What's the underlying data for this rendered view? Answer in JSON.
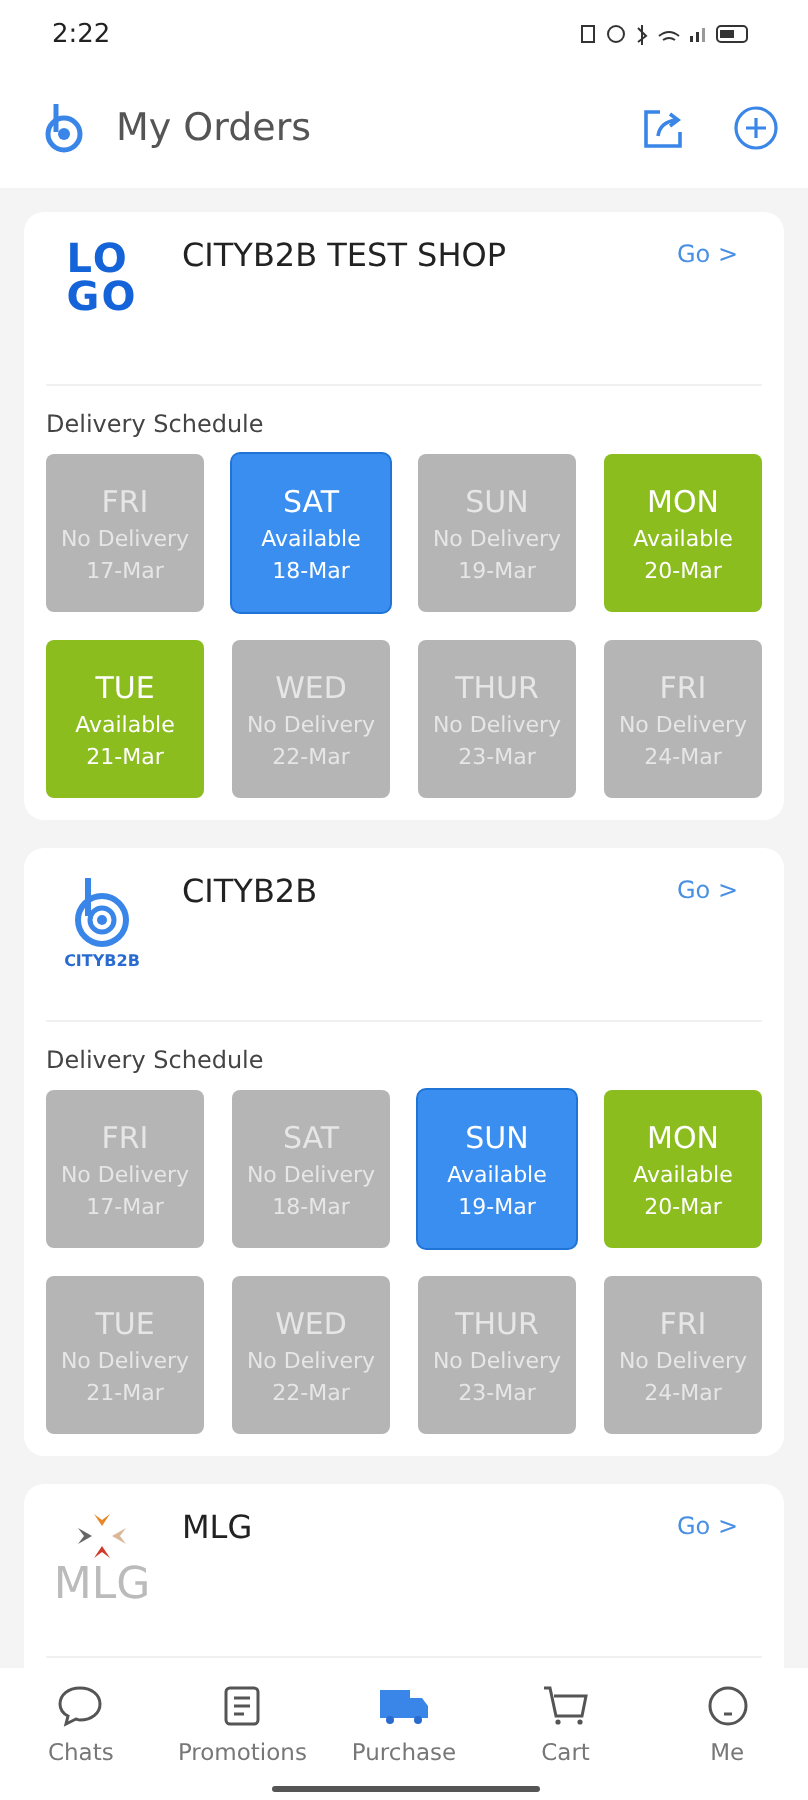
{
  "status_bar": {
    "time": "2:22"
  },
  "header": {
    "title": "My Orders"
  },
  "shops": [
    {
      "name": "CITYB2B TEST SHOP",
      "logo": {
        "kind": "letters",
        "lines": [
          "LO",
          "GO"
        ]
      },
      "go": "Go >",
      "schedule_label": "Delivery Schedule",
      "days": [
        {
          "day": "FRI",
          "status": "No Delivery",
          "date": "17-Mar",
          "available": false,
          "selected": false
        },
        {
          "day": "SAT",
          "status": "Available",
          "date": "18-Mar",
          "available": true,
          "selected": true
        },
        {
          "day": "SUN",
          "status": "No Delivery",
          "date": "19-Mar",
          "available": false,
          "selected": false
        },
        {
          "day": "MON",
          "status": "Available",
          "date": "20-Mar",
          "available": true,
          "selected": false
        },
        {
          "day": "TUE",
          "status": "Available",
          "date": "21-Mar",
          "available": true,
          "selected": false
        },
        {
          "day": "WED",
          "status": "No Delivery",
          "date": "22-Mar",
          "available": false,
          "selected": false
        },
        {
          "day": "THUR",
          "status": "No Delivery",
          "date": "23-Mar",
          "available": false,
          "selected": false
        },
        {
          "day": "FRI",
          "status": "No Delivery",
          "date": "24-Mar",
          "available": false,
          "selected": false
        }
      ]
    },
    {
      "name": "CITYB2B",
      "logo": {
        "kind": "swirl",
        "caption": "CITYB2B"
      },
      "go": "Go >",
      "schedule_label": "Delivery Schedule",
      "days": [
        {
          "day": "FRI",
          "status": "No Delivery",
          "date": "17-Mar",
          "available": false,
          "selected": false
        },
        {
          "day": "SAT",
          "status": "No Delivery",
          "date": "18-Mar",
          "available": false,
          "selected": false
        },
        {
          "day": "SUN",
          "status": "Available",
          "date": "19-Mar",
          "available": true,
          "selected": true
        },
        {
          "day": "MON",
          "status": "Available",
          "date": "20-Mar",
          "available": true,
          "selected": false
        },
        {
          "day": "TUE",
          "status": "No Delivery",
          "date": "21-Mar",
          "available": false,
          "selected": false
        },
        {
          "day": "WED",
          "status": "No Delivery",
          "date": "22-Mar",
          "available": false,
          "selected": false
        },
        {
          "day": "THUR",
          "status": "No Delivery",
          "date": "23-Mar",
          "available": false,
          "selected": false
        },
        {
          "day": "FRI",
          "status": "No Delivery",
          "date": "24-Mar",
          "available": false,
          "selected": false
        }
      ]
    },
    {
      "name": "MLG",
      "logo": {
        "kind": "arrows",
        "caption": "MLG"
      },
      "go": "Go >"
    }
  ],
  "nav": [
    {
      "label": "Chats",
      "kind": "chat",
      "selected": false
    },
    {
      "label": "Promotions",
      "kind": "doc",
      "selected": false
    },
    {
      "label": "Purchase",
      "kind": "truck",
      "selected": true
    },
    {
      "label": "Cart",
      "kind": "cart",
      "selected": false
    },
    {
      "label": "Me",
      "kind": "face",
      "selected": false
    }
  ]
}
